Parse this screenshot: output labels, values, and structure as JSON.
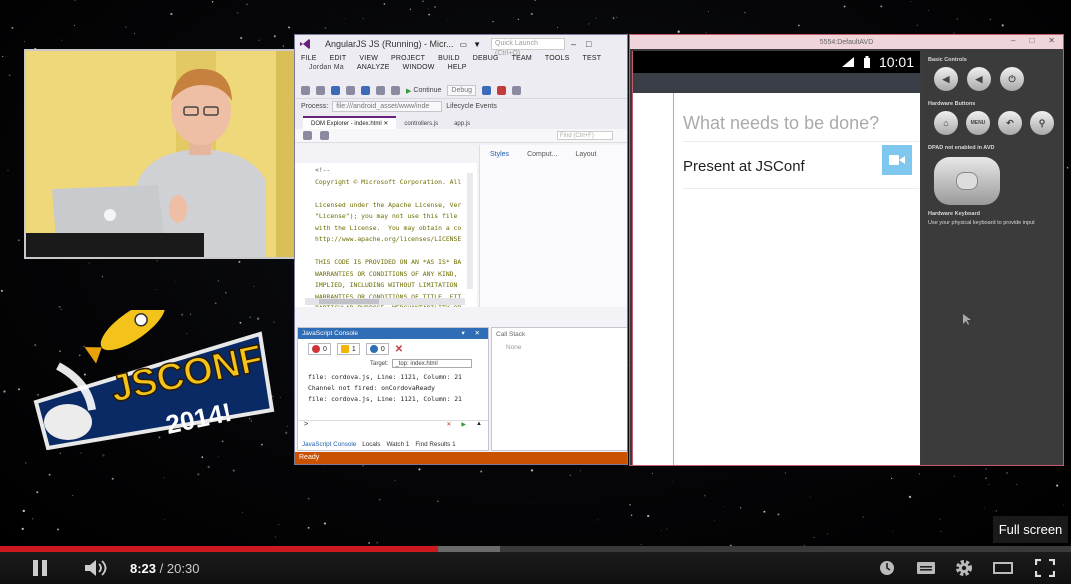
{
  "visual_studio": {
    "window_title": "AngularJS JS (Running) - Micr...",
    "quick_launch": "Quick Launch (Ctrl+Q)",
    "user": "Jordan Ma",
    "menu": [
      "FILE",
      "EDIT",
      "VIEW",
      "PROJECT",
      "BUILD",
      "DEBUG",
      "TEAM",
      "TOOLS",
      "TEST",
      "ANALYZE",
      "WINDOW",
      "HELP"
    ],
    "toolbar": {
      "continue_label": "Continue",
      "config_value": "Debug"
    },
    "process_label": "Process:",
    "process_value": "file:///android_asset/www/inde",
    "lifecycle_label": "Lifecycle Events",
    "tabs": [
      "DOM Explorer - index.html",
      "controllers.js",
      "app.js"
    ],
    "find_placeholder": "Find (Ctrl+F)",
    "styles_tabs": [
      "Styles",
      "Comput...",
      "Layout"
    ],
    "code_lines": [
      "<!--",
      "Copyright © Microsoft Corporation. All",
      "",
      "Licensed under the Apache License, Ver",
      "\"License\"); you may not use this file",
      "with the License.  You may obtain a co",
      "http://www.apache.org/licenses/LICENSE",
      "",
      "THIS CODE IS PROVIDED ON AN *AS IS* BA",
      "WARRANTIES OR CONDITIONS OF ANY KIND,",
      "IMPLIED, INCLUDING WITHOUT LIMITATION",
      "WARRANTIES OR CONDITIONS OF TITLE, FIT",
      "PARTICULAR PURPOSE, MERCHANTABILITY OR"
    ],
    "console": {
      "title": "JavaScript Console",
      "errors": "0",
      "warnings": "1",
      "messages": "0",
      "target_label": "Target:",
      "target_value": "_top: index.html",
      "lines": [
        "file: cordova.js, Line: 1121, Column: 21",
        "Channel not fired: onCordovaReady",
        "file: cordova.js, Line: 1121, Column: 21"
      ],
      "prompt": ">",
      "bottom_tabs": [
        "JavaScript Console",
        "Locals",
        "Watch 1",
        "Find Results 1"
      ]
    },
    "call_stack": {
      "title": "Call Stack",
      "empty": "None"
    },
    "status": "Ready"
  },
  "emulator": {
    "title": "5554:DefaultAVD",
    "time": "10:01",
    "input_placeholder": "What needs to be done?",
    "todo_item": "Present at JSConf",
    "controls": {
      "basic_label": "Basic Controls",
      "hardware_label": "Hardware Buttons",
      "menu_label": "MENU",
      "dpad_label": "DPAD not enabled in AVD",
      "keyboard_label": "Hardware Keyboard",
      "keyboard_hint": "Use your physical keyboard to provide input"
    }
  },
  "logo": {
    "line1": "JSCONF",
    "line2": "2014!"
  },
  "player": {
    "current_time": "8:23",
    "separator": "/",
    "duration": "20:30",
    "progress": 0.409,
    "buffered": 0.467,
    "tooltip": "Full screen",
    "icons": [
      "pause-icon",
      "volume-icon",
      "watch-later-icon",
      "captions-icon",
      "settings-icon",
      "theater-icon",
      "fullscreen-icon"
    ]
  },
  "colors": {
    "accent": "#cc181e",
    "vs_status": "#ca5100",
    "console_head": "#2f6db6",
    "camera_button": "#7ec8f0"
  }
}
